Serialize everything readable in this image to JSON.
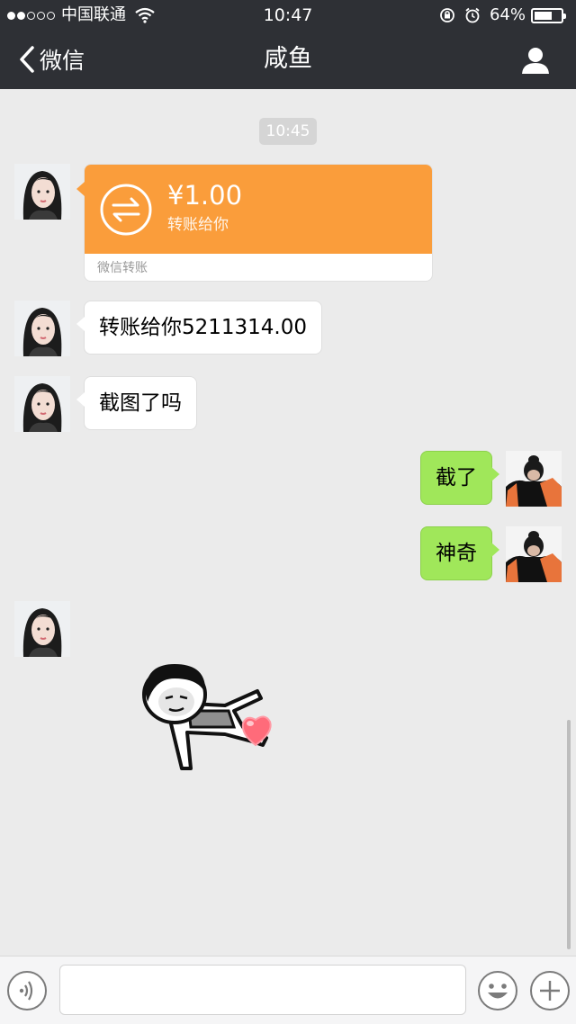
{
  "status_bar": {
    "carrier": "中国联通",
    "time": "10:47",
    "battery": "64%"
  },
  "nav": {
    "back_label": "微信",
    "title": "咸鱼"
  },
  "chat": {
    "timestamp": "10:45",
    "transfer": {
      "amount": "¥1.00",
      "memo": "转账给你",
      "footer": "微信转账",
      "color": "#fa9d3b"
    },
    "messages": [
      {
        "side": "left",
        "text": "转账给你5211314.00"
      },
      {
        "side": "left",
        "text": "截图了吗"
      },
      {
        "side": "right",
        "text": "截了"
      },
      {
        "side": "right",
        "text": "神奇"
      }
    ]
  },
  "colors": {
    "header_bg": "#2e3035",
    "chat_bg": "#ebebeb",
    "sent_bubble": "#a0e75a"
  },
  "input_bar": {
    "placeholder": ""
  }
}
